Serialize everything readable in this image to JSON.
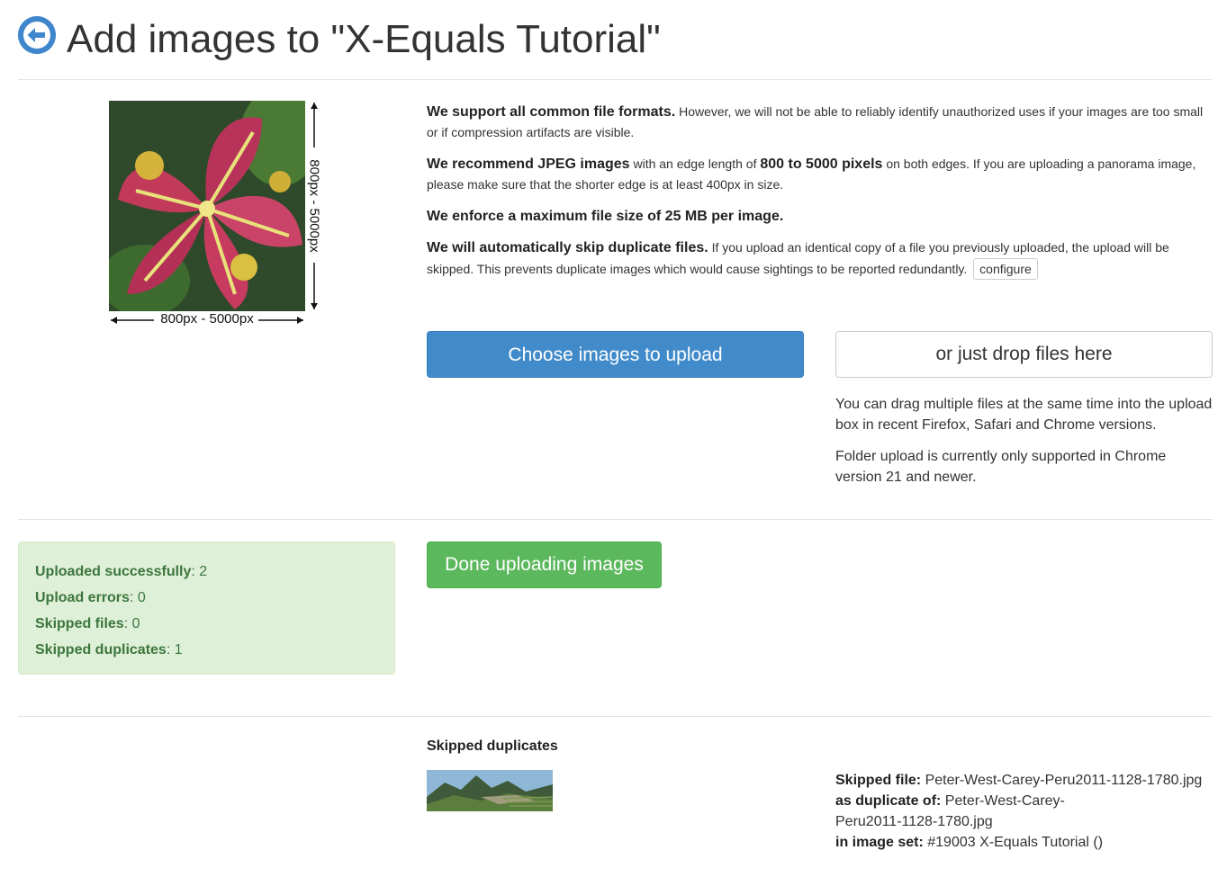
{
  "header": {
    "back_icon": "arrow-left-circle-icon",
    "title": "Add images to \"X-Equals Tutorial\""
  },
  "sample_image": {
    "width_label": "800px - 5000px",
    "height_label": "800px - 5000px"
  },
  "info": {
    "formats_bold": "We support all common file formats.",
    "formats_text": " However, we will not be able to reliably identify unauthorized uses if your images are too small or if compression artifacts are visible.",
    "jpeg_bold": "We recommend JPEG images",
    "jpeg_text_1": " with an edge length of ",
    "jpeg_bold_2": "800 to 5000 pixels",
    "jpeg_text_2": " on both edges. If you are uploading a panorama image, please make sure that the shorter edge is at least 400px in size.",
    "max_size": "We enforce a maximum file size of 25 MB per image.",
    "skip_bold": "We will automatically skip duplicate files.",
    "skip_text": " If you upload an identical copy of a file you previously uploaded, the upload will be skipped. This prevents duplicate images which would cause sightings to be reported redundantly.",
    "configure_label": "configure"
  },
  "upload": {
    "choose_label": "Choose images to upload",
    "drop_label": "or just drop files here",
    "drop_note_1": "You can drag multiple files at the same time into the upload box in recent Firefox, Safari and Chrome versions.",
    "drop_note_2": "Folder upload is currently only supported in Chrome version 21 and newer."
  },
  "status": {
    "uploaded_label": "Uploaded successfully",
    "uploaded_value": ": 2",
    "errors_label": "Upload errors",
    "errors_value": ": 0",
    "skipped_label": "Skipped files",
    "skipped_value": ": 0",
    "dups_label": "Skipped duplicates",
    "dups_value": ": 1"
  },
  "done_label": "Done uploading images",
  "duplicates": {
    "heading": "Skipped duplicates",
    "skipped_file_label": "Skipped file:",
    "skipped_file_value": " Peter-West-Carey-Peru2011-1128-1780.jpg",
    "duplicate_of_label": "as duplicate of:",
    "duplicate_of_value": " Peter-West-Carey-Peru2011-1128-1780.jpg",
    "image_set_label": "in image set:",
    "image_set_value": " #19003 X-Equals Tutorial ()"
  },
  "colors": {
    "primary": "#428bca",
    "success": "#5cb85c",
    "success_bg": "#dff0d8",
    "success_text": "#3c763d"
  }
}
